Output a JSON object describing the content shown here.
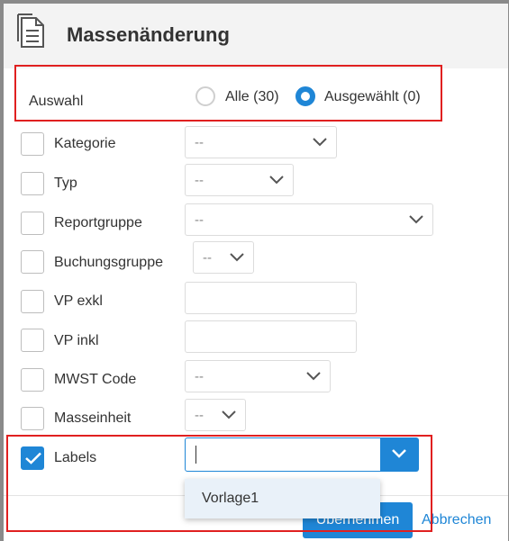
{
  "dialog": {
    "title": "Massenänderung",
    "icon": "document-icon"
  },
  "selection": {
    "label": "Auswahl",
    "options": [
      {
        "label": "Alle (30)",
        "selected": false
      },
      {
        "label": "Ausgewählt (0)",
        "selected": true
      }
    ]
  },
  "fields": [
    {
      "label": "Kategorie",
      "checked": false,
      "control": "select",
      "value": "--"
    },
    {
      "label": "Typ",
      "checked": false,
      "control": "select",
      "value": "--"
    },
    {
      "label": "Reportgruppe",
      "checked": false,
      "control": "select",
      "value": "--"
    },
    {
      "label": "Buchungsgruppe",
      "checked": false,
      "control": "select",
      "value": "--"
    },
    {
      "label": "VP exkl",
      "checked": false,
      "control": "text",
      "value": ""
    },
    {
      "label": "VP inkl",
      "checked": false,
      "control": "text",
      "value": ""
    },
    {
      "label": "MWST Code",
      "checked": false,
      "control": "select",
      "value": "--"
    },
    {
      "label": "Masseinheit",
      "checked": false,
      "control": "select",
      "value": "--"
    },
    {
      "label": "Labels",
      "checked": true,
      "control": "combobox",
      "value": ""
    }
  ],
  "labels_dropdown": {
    "options": [
      "Vorlage1"
    ]
  },
  "footer": {
    "primary_label": "Übernehmen",
    "cancel_label": "Abbrechen"
  },
  "colors": {
    "accent": "#1f86d6",
    "highlight": "#e02020"
  }
}
